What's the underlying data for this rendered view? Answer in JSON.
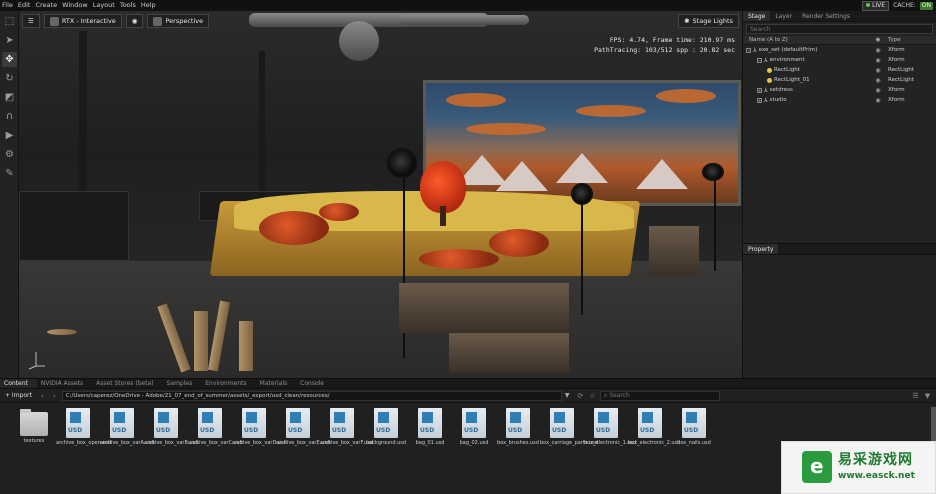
{
  "menubar": {
    "items": [
      "File",
      "Edit",
      "Create",
      "Window",
      "Layout",
      "Tools",
      "Help"
    ],
    "live_label": "LIVE",
    "cache_label": "CACHE:",
    "cache_state": "ON"
  },
  "viewport": {
    "render_mode": "RTX - Interactive",
    "camera": "Perspective",
    "stage_lights": "Stage Lights",
    "stats": {
      "line1": "FPS: 4.74, Frame time: 210.97 ms",
      "line2": "PathTracing: 103/512 spp : 20.82 sec"
    }
  },
  "stage": {
    "tabs": [
      "Stage",
      "Layer",
      "Render Settings"
    ],
    "search_placeholder": "Search",
    "columns": {
      "name": "Name (A to Z)",
      "type": "Type"
    },
    "rows": [
      {
        "name": "exe_set (defaultPrim)",
        "type": "Xform",
        "indent": 0
      },
      {
        "name": "environment",
        "type": "Xform",
        "indent": 1
      },
      {
        "name": "RectLight",
        "type": "RectLight",
        "indent": 2
      },
      {
        "name": "RectLight_01",
        "type": "RectLight",
        "indent": 2
      },
      {
        "name": "setdress",
        "type": "Xform",
        "indent": 1
      },
      {
        "name": "studio",
        "type": "Xform",
        "indent": 1
      }
    ]
  },
  "property": {
    "title": "Property"
  },
  "content": {
    "tabs": [
      "Content",
      "NVIDIA Assets",
      "Asset Stores (beta)",
      "Samples",
      "Environments",
      "Materials",
      "Console"
    ],
    "import_label": "+ Import",
    "path": "C:/Users/caperez/OneDrive - Adobe/21_07_end_of_summer/assets/_export/usd_clean/resources/",
    "search_placeholder": "Search",
    "items": [
      {
        "label": "textures",
        "kind": "folder"
      },
      {
        "label": "archive_box_open.usd",
        "kind": "usd"
      },
      {
        "label": "archive_box_varA.usd",
        "kind": "usd"
      },
      {
        "label": "archive_box_varB.usd",
        "kind": "usd"
      },
      {
        "label": "archive_box_varC.usd",
        "kind": "usd"
      },
      {
        "label": "archive_box_varD.usd",
        "kind": "usd"
      },
      {
        "label": "archive_box_varE.usd",
        "kind": "usd"
      },
      {
        "label": "archive_box_varF.usd",
        "kind": "usd"
      },
      {
        "label": "background.usd",
        "kind": "usd"
      },
      {
        "label": "bag_01.usd",
        "kind": "usd"
      },
      {
        "label": "bag_02.usd",
        "kind": "usd"
      },
      {
        "label": "box_brushes.usd",
        "kind": "usd"
      },
      {
        "label": "box_carriage_parts.usd",
        "kind": "usd"
      },
      {
        "label": "box_electronic_1.usd",
        "kind": "usd"
      },
      {
        "label": "box_electronic_2.usd",
        "kind": "usd"
      },
      {
        "label": "box_nails.usd",
        "kind": "usd"
      }
    ]
  },
  "watermark": {
    "title": "易采游戏网",
    "url": "www.easck.net"
  }
}
